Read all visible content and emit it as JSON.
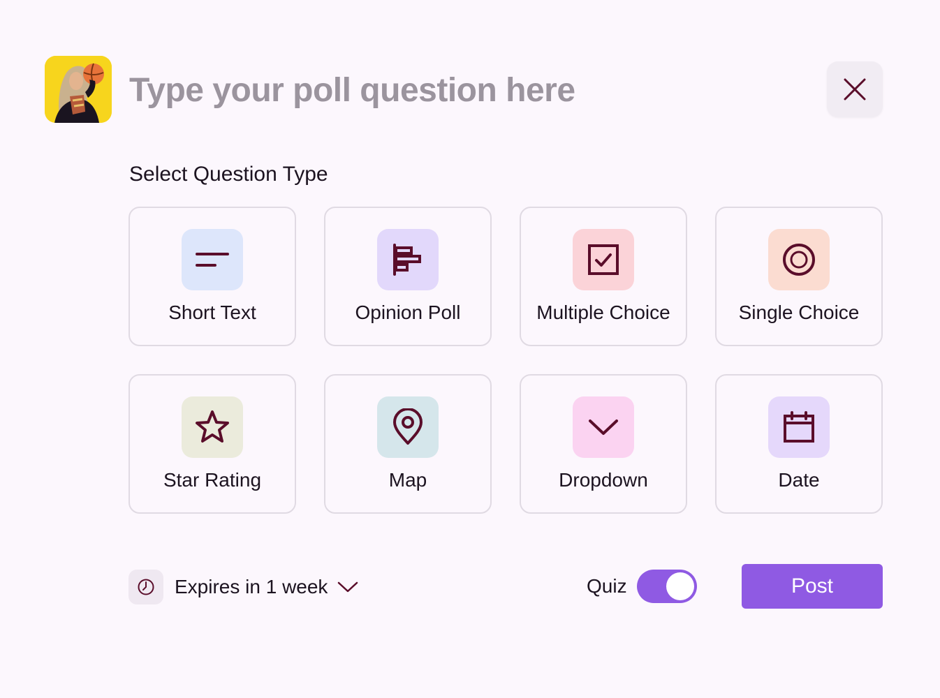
{
  "composer": {
    "avatar_alt": "User avatar",
    "question_placeholder": "Type your poll question here",
    "close_icon": "close-icon"
  },
  "question_type": {
    "title": "Select Question Type",
    "options": [
      {
        "label": "Short Text",
        "icon": "short-text-icon",
        "tint": "#dde6fb"
      },
      {
        "label": "Opinion Poll",
        "icon": "bar-chart-icon",
        "tint": "#e2d8fb"
      },
      {
        "label": "Multiple Choice",
        "icon": "checkbox-icon",
        "tint": "#fbd3d8"
      },
      {
        "label": "Single Choice",
        "icon": "radio-icon",
        "tint": "#fbdcd1"
      },
      {
        "label": "Star Rating",
        "icon": "star-icon",
        "tint": "#ebebdc"
      },
      {
        "label": "Map",
        "icon": "map-pin-icon",
        "tint": "#d5e6eb"
      },
      {
        "label": "Dropdown",
        "icon": "chevron-down-icon",
        "tint": "#fbd3f1"
      },
      {
        "label": "Date",
        "icon": "calendar-icon",
        "tint": "#e5d8fb"
      }
    ]
  },
  "footer": {
    "expiry_label": "Expires in 1 week",
    "quiz_label": "Quiz",
    "quiz_enabled": true,
    "post_label": "Post"
  },
  "colors": {
    "accent": "#8f5ae3",
    "icon_stroke": "#5a0d2a",
    "background": "#fcf7fd"
  }
}
